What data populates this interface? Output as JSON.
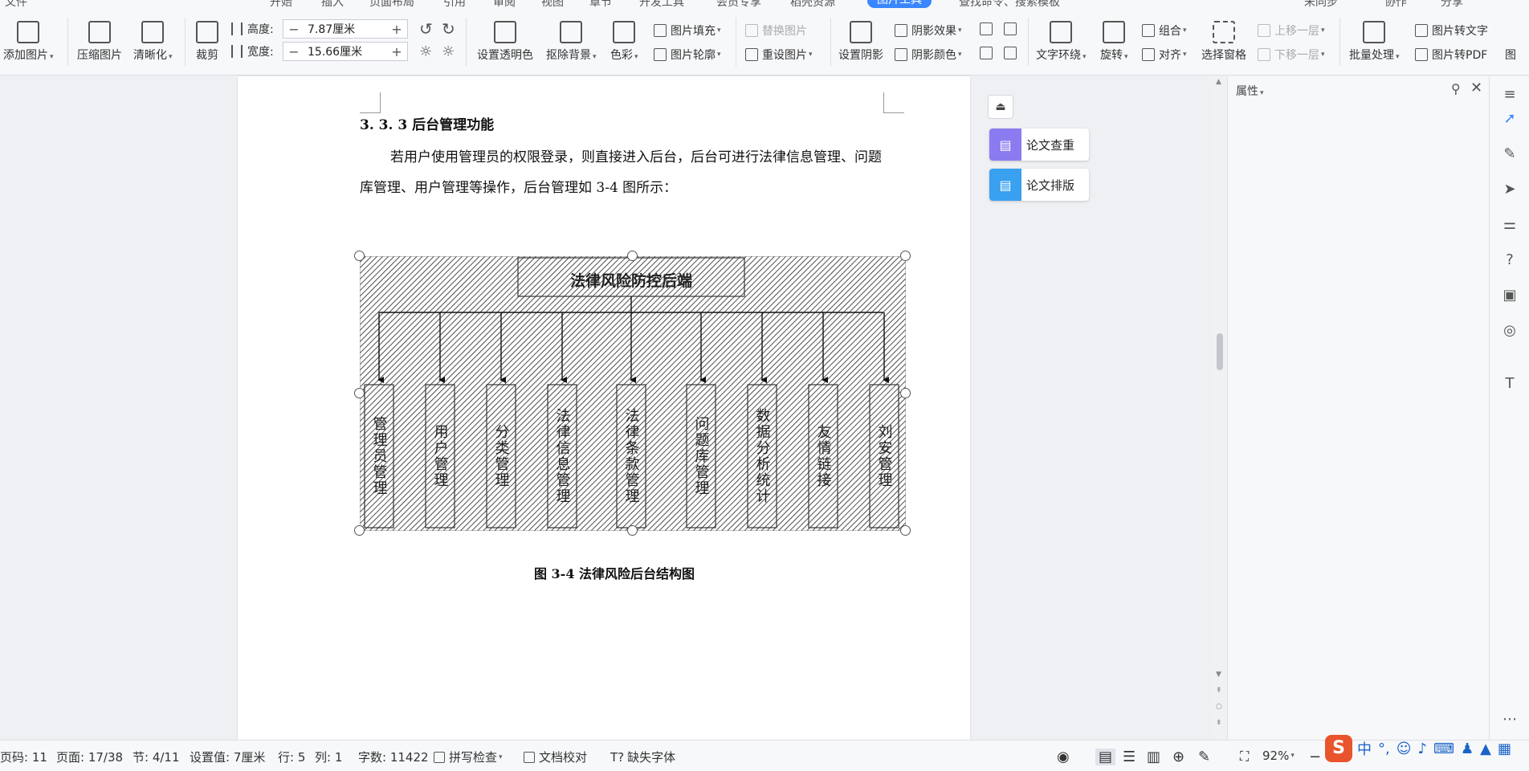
{
  "tabs": [
    "文件",
    "开始",
    "插入",
    "页面布局",
    "引用",
    "审阅",
    "视图",
    "章节",
    "开发工具",
    "会员专享",
    "稻壳资源",
    "图片工具",
    "查找命令、搜索模板",
    "未同步",
    "协作",
    "分享"
  ],
  "ribbon": {
    "add_picture": "添加图片",
    "compress_picture": "压缩图片",
    "sharpen": "清晰化",
    "crop": "裁剪",
    "height_label": "高度:",
    "height_value": "7.87厘米",
    "width_label": "宽度:",
    "width_value": "15.66厘米",
    "set_transparency": "设置透明色",
    "remove_background": "抠除背景",
    "color": "色彩",
    "picture_fill": "图片填充",
    "picture_outline": "图片轮廓",
    "replace_picture": "替换图片",
    "reset_picture": "重设图片",
    "set_shadow": "设置阴影",
    "shadow_effect": "阴影效果",
    "shadow_color": "阴影颜色",
    "text_wrap": "文字环绕",
    "rotate": "旋转",
    "group": "组合",
    "align": "对齐",
    "selection_pane": "选择窗格",
    "bring_forward": "上移一层",
    "send_backward": "下移一层",
    "batch_process": "批量处理",
    "picture_to_text": "图片转文字",
    "picture_to_pdf": "图片转PDF",
    "picture_more": "图"
  },
  "document": {
    "heading": "3. 3. 3  后台管理功能",
    "paragraph": "若用户使用管理员的权限登录，则直接进入后台，后台可进行法律信息管理、问题库管理、用户管理等操作，后台管理如 3-4 图所示：",
    "caption": "图 3-4 法律风险后台结构图"
  },
  "diagram": {
    "root": "法律风险防控后端",
    "children": [
      "管理员管理",
      "用户管理",
      "分类管理",
      "法律信息管理",
      "法律条款管理",
      "问题库管理",
      "数据分析统计",
      "友情链接",
      "刘安管理"
    ]
  },
  "assistant": {
    "plagiarism_check": "论文查重",
    "formatting": "论文排版"
  },
  "pane": {
    "title": "属性"
  },
  "status": {
    "page_code": "页码: 11",
    "page": "页面: 17/38",
    "section": "节: 4/11",
    "setting": "设置值: 7厘米",
    "row": "行: 5",
    "col": "列: 1",
    "word_count": "字数: 11422",
    "spell_check": "拼写检查",
    "doc_proof": "文档校对",
    "missing_font": "缺失字体",
    "zoom": "92%"
  },
  "ime": {
    "lang": "中"
  },
  "colors": {
    "accent": "#3a86ff",
    "assist_purple": "#8a7cf0",
    "assist_blue": "#3aa0f0",
    "ime_orange": "#e8542c"
  }
}
